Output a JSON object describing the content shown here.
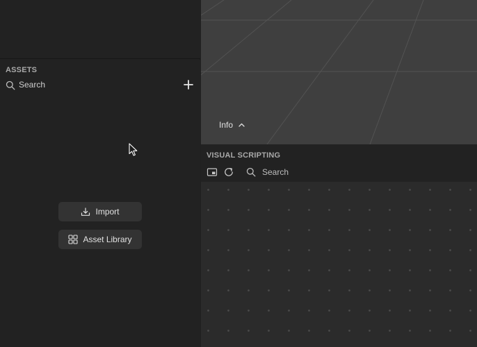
{
  "assets": {
    "title": "ASSETS",
    "search_placeholder": "Search",
    "buttons": {
      "import": "Import",
      "asset_library": "Asset Library"
    }
  },
  "viewport": {
    "info_label": "Info"
  },
  "visual_scripting": {
    "title": "VISUAL SCRIPTING",
    "search_placeholder": "Search"
  },
  "icons": {
    "search": "search-icon",
    "add": "plus-icon",
    "import": "download-icon",
    "asset_library": "grid-icon",
    "chevron": "chevron-up-icon",
    "preview": "preview-window-icon",
    "refresh": "refresh-icon",
    "cursor": "mouse-pointer-icon"
  },
  "colors": {
    "panel_bg": "#222222",
    "viewport_bg": "#3f3f3f",
    "button_bg": "#333333",
    "canvas_bg": "#2b2b2b"
  }
}
